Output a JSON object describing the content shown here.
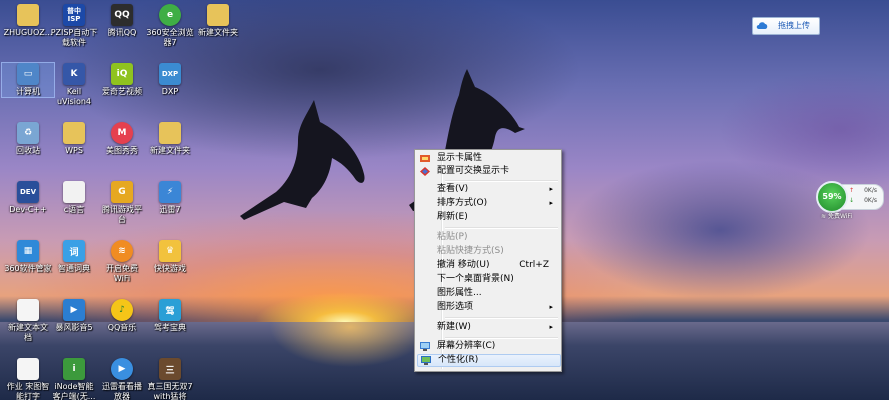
{
  "desktop_icons": [
    {
      "label": "ZHUGUOZ...",
      "icon": "folder-icon",
      "color": "#e7c35a"
    },
    {
      "label": "PZISP自动下\n载软件",
      "icon": "isp-app-icon",
      "color": "#1c49a8",
      "glyph": "普中\nISP"
    },
    {
      "label": "腾讯QQ",
      "icon": "qq-penguin-icon",
      "color": "#2d2d2d",
      "glyph": "QQ"
    },
    {
      "label": "360安全浏览\n器7",
      "icon": "360-browser-icon",
      "color": "#3fae45",
      "glyph": "e"
    },
    {
      "label": "新建文件夹",
      "icon": "folder-icon",
      "color": "#e7c35a"
    },
    {
      "label": "计算机",
      "icon": "computer-icon",
      "color": "#4f86c8"
    },
    {
      "label": "Keil\nuVision4",
      "icon": "keil-icon",
      "color": "#3557a8",
      "glyph": "K"
    },
    {
      "label": "爱奇艺视频",
      "icon": "iqiyi-icon",
      "color": "#8fc31f",
      "glyph": "iQ"
    },
    {
      "label": "DXP",
      "icon": "dxp-icon",
      "color": "#3b8bd1",
      "glyph": "DXP"
    },
    {
      "label": "回收站",
      "icon": "recycle-bin-icon",
      "color": "#7aa6d3"
    },
    {
      "label": "WPS",
      "icon": "wps-folder-icon",
      "color": "#e7c35a"
    },
    {
      "label": "美图秀秀",
      "icon": "meitu-icon",
      "color": "#e5404f",
      "glyph": "M"
    },
    {
      "label": "新建文件夹",
      "icon": "folder-icon",
      "color": "#e7c35a"
    },
    {
      "label": "Dev-C++",
      "icon": "devcpp-icon",
      "color": "#2a4f9a",
      "glyph": "DEV"
    },
    {
      "label": "c语言",
      "icon": "document-icon",
      "color": "#f2f2f2"
    },
    {
      "label": "腾讯游戏平\n台",
      "icon": "tencent-games-icon",
      "color": "#e6a821",
      "glyph": "G"
    },
    {
      "label": "迅雷7",
      "icon": "xunlei-icon",
      "color": "#3b86d6",
      "glyph": "⚡"
    },
    {
      "label": "360软件管家",
      "icon": "360-software-icon",
      "color": "#2f89d8",
      "glyph": "▦"
    },
    {
      "label": "智通词典",
      "icon": "dictionary-icon",
      "color": "#3aa0e6",
      "glyph": "词"
    },
    {
      "label": "开启免费\nWiFi",
      "icon": "wifi-icon",
      "color": "#f08c22",
      "glyph": "≋"
    },
    {
      "label": "快快游戏",
      "icon": "game-icon",
      "color": "#f2c23d",
      "glyph": "♛"
    },
    {
      "label": "新建文本文\n档",
      "icon": "text-file-icon",
      "color": "#f5f5f5"
    },
    {
      "label": "暴风影音5",
      "icon": "baofeng-icon",
      "color": "#2b7ed1",
      "glyph": "▶"
    },
    {
      "label": "QQ音乐",
      "icon": "qq-music-icon",
      "color": "#f5c518",
      "glyph": "♪"
    },
    {
      "label": "驾考宝典",
      "icon": "jiakao-icon",
      "color": "#2a9fd6",
      "glyph": "驾"
    },
    {
      "label": "作业 宋图智\n能打字",
      "icon": "document-icon",
      "color": "#f5f5f5"
    },
    {
      "label": "iNode智能\n客户端(无...",
      "icon": "inode-icon",
      "color": "#3c9a3c",
      "glyph": "i"
    },
    {
      "label": "迅雷看看播\n放器",
      "icon": "xunlei-kankan-icon",
      "color": "#3a8fe0",
      "glyph": "▶"
    },
    {
      "label": "真三国无双7\nwith猛将",
      "icon": "game-cover-icon",
      "color": "#6b4a2e",
      "glyph": "三"
    }
  ],
  "context_menu": {
    "items": [
      {
        "label": "显示卡属性",
        "icon": "graphics-properties-icon"
      },
      {
        "label": "配置可交换显示卡",
        "icon": "switchable-graphics-icon"
      },
      {
        "separator": true
      },
      {
        "label": "查看(V)",
        "submenu": true
      },
      {
        "label": "排序方式(O)",
        "submenu": true
      },
      {
        "label": "刷新(E)"
      },
      {
        "separator": true
      },
      {
        "label": "粘贴(P)",
        "disabled": true
      },
      {
        "label": "粘贴快捷方式(S)",
        "disabled": true
      },
      {
        "label": "撤消 移动(U)",
        "shortcut": "Ctrl+Z"
      },
      {
        "label": "下一个桌面背景(N)"
      },
      {
        "label": "图形属性..."
      },
      {
        "label": "图形选项",
        "submenu": true
      },
      {
        "separator": true
      },
      {
        "label": "新建(W)",
        "submenu": true
      },
      {
        "separator": true
      },
      {
        "label": "屏幕分辨率(C)",
        "icon": "screen-resolution-icon"
      },
      {
        "label": "个性化(R)",
        "icon": "personalize-icon",
        "highlighted": true
      }
    ],
    "submenu_arrow": "▸"
  },
  "upload_button": {
    "label": "拖拽上传",
    "icon": "cloud-upload-icon"
  },
  "speed_widget": {
    "percent": "59%",
    "upload_rate": "0K/s",
    "download_rate": "0K/s",
    "wifi_label": "免费WiFi",
    "up_arrow": "↑",
    "down_arrow": "↓"
  },
  "colors": {
    "menu_bg": "#f0f0f0",
    "menu_highlight": "#d7e7fa",
    "widget_green": "#3fae45"
  }
}
